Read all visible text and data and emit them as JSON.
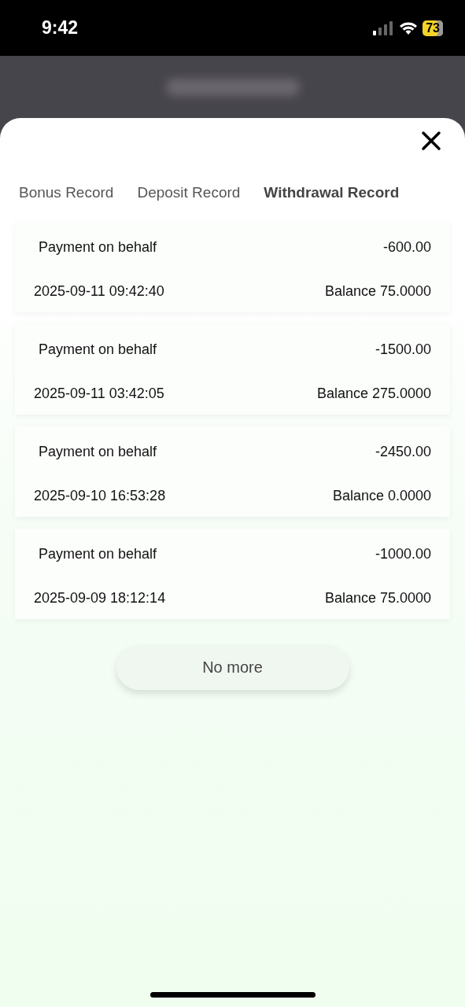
{
  "status_bar": {
    "time": "9:42",
    "battery": "73"
  },
  "tabs": [
    {
      "label": "Bonus Record",
      "selected": false
    },
    {
      "label": "Deposit Record",
      "selected": false
    },
    {
      "label": "Withdrawal Record",
      "selected": true
    }
  ],
  "records": [
    {
      "type": "Payment on behalf",
      "amount": "-600.00",
      "time": "2025-09-11 09:42:40",
      "balance": "Balance 75.0000"
    },
    {
      "type": "Payment on behalf",
      "amount": "-1500.00",
      "time": "2025-09-11 03:42:05",
      "balance": "Balance 275.0000"
    },
    {
      "type": "Payment on behalf",
      "amount": "-2450.00",
      "time": "2025-09-10 16:53:28",
      "balance": "Balance 0.0000"
    },
    {
      "type": "Payment on behalf",
      "amount": "-1000.00",
      "time": "2025-09-09 18:12:14",
      "balance": "Balance 75.0000"
    }
  ],
  "end_button": "No more"
}
